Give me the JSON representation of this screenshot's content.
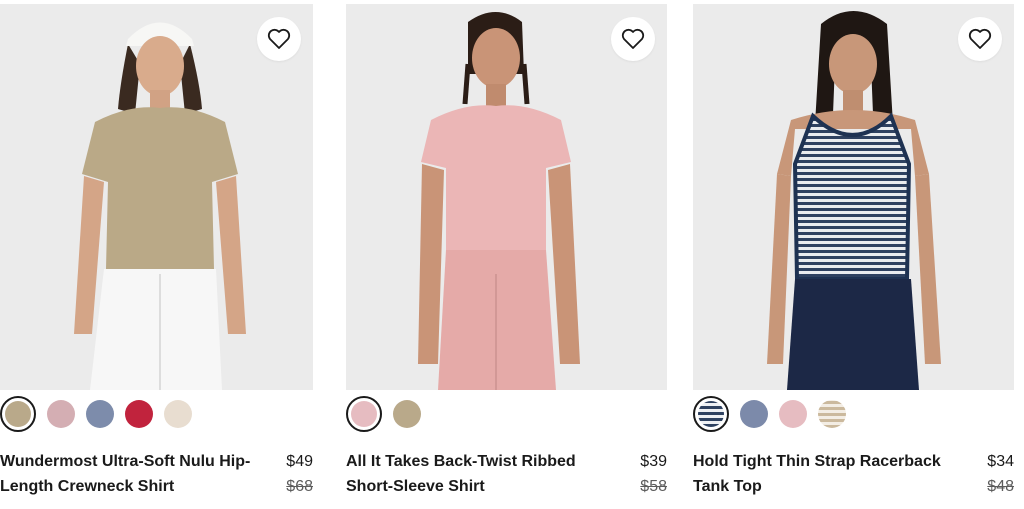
{
  "products": [
    {
      "name": "Wundermost Ultra-Soft Nulu Hip-Length Crewneck Shirt",
      "price": "$49",
      "original_price": "$68",
      "favorite_icon": "heart-outline-icon",
      "photo_bg": "#ebebeb",
      "swatches": [
        {
          "color": "#b9a98a",
          "selected": true
        },
        {
          "color": "#d4aeb3",
          "selected": false
        },
        {
          "color": "#7d8cab",
          "selected": false
        },
        {
          "color": "#c1233d",
          "selected": false
        },
        {
          "color": "#e8ddd0",
          "selected": false
        }
      ]
    },
    {
      "name": "All It Takes Back-Twist Ribbed Short-Sleeve Shirt",
      "price": "$39",
      "original_price": "$58",
      "favorite_icon": "heart-outline-icon",
      "photo_bg": "#ebebeb",
      "swatches": [
        {
          "color": "#e6bcc1",
          "selected": true
        },
        {
          "color": "#b9a98a",
          "selected": false
        }
      ]
    },
    {
      "name": "Hold Tight Thin Strap Racerback Tank Top",
      "price": "$34",
      "original_price": "$48",
      "favorite_icon": "heart-outline-icon",
      "photo_bg": "#ebebeb",
      "swatches": [
        {
          "color": "stripe-navy",
          "selected": true
        },
        {
          "color": "#7c8aaa",
          "selected": false
        },
        {
          "color": "#e6bcc1",
          "selected": false
        },
        {
          "color": "stripe-tan",
          "selected": false
        }
      ]
    }
  ]
}
